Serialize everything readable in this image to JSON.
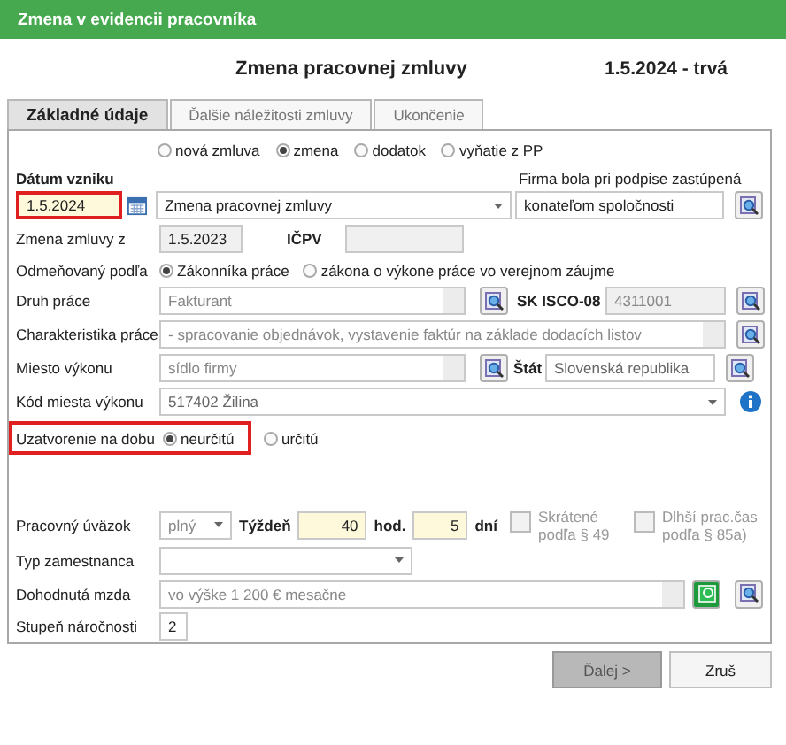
{
  "window": {
    "title": "Zmena v evidencii pracovníka"
  },
  "header": {
    "title": "Zmena pracovnej zmluvy",
    "period": "1.5.2024 - trvá"
  },
  "tabs": [
    {
      "label": "Základné údaje",
      "selected": true
    },
    {
      "label": "Ďalšie náležitosti zmluvy",
      "selected": false
    },
    {
      "label": "Ukončenie",
      "selected": false
    }
  ],
  "contract_type": [
    {
      "label": "nová zmluva",
      "selected": false
    },
    {
      "label": "zmena",
      "selected": true
    },
    {
      "label": "dodatok",
      "selected": false
    },
    {
      "label": "vyňatie z PP",
      "selected": false
    }
  ],
  "start_date": {
    "label": "Dátum vzniku",
    "value": "1.5.2024",
    "highlighted": true
  },
  "change_type": {
    "value": "Zmena pracovnej zmluvy"
  },
  "represented_by": {
    "label": "Firma bola pri podpise zastúpená",
    "value": "konateľom spoločnosti"
  },
  "changed_contract": {
    "label": "Zmena zmluvy z",
    "value": "1.5.2023"
  },
  "icpv": {
    "label": "IČPV"
  },
  "paid_by": {
    "label": "Odmeňovaný podľa",
    "options": [
      {
        "label": "Zákonníka práce",
        "selected": true
      },
      {
        "label": "zákona o výkone práce vo verejnom záujme",
        "selected": false
      }
    ]
  },
  "job": {
    "label": "Druh práce",
    "value": "Fakturant"
  },
  "isco": {
    "label": "SK ISCO-08",
    "value": "4311001"
  },
  "job_description": {
    "label": "Charakteristika práce",
    "value": "- spracovanie objednávok, vystavenie faktúr na základe dodacích listov"
  },
  "workplace": {
    "label": "Miesto výkonu",
    "value": "sídlo firmy"
  },
  "country": {
    "label": "Štát",
    "value": "Slovenská republika"
  },
  "workplace_code": {
    "label": "Kód miesta výkonu",
    "value": "517402 Žilina"
  },
  "duration": {
    "label": "Uzatvorenie na dobu",
    "highlighted": true,
    "options": [
      {
        "label": "neurčitú",
        "selected": true
      },
      {
        "label": "určitú",
        "selected": false
      }
    ]
  },
  "workload": {
    "label": "Pracovný úväzok",
    "value": "plný",
    "week_label": "Týždeň",
    "hours": "40",
    "hours_unit": "hod.",
    "days": "5",
    "days_unit": "dní",
    "checks": [
      {
        "label": "Skrátené podľa § 49",
        "checked": false,
        "disabled": true
      },
      {
        "label": "Dlhší prac.čas podľa § 85a)",
        "checked": false,
        "disabled": true
      }
    ]
  },
  "employee_type": {
    "label": "Typ zamestnanca"
  },
  "wage": {
    "label": "Dohodnutá mzda",
    "value": "vo výške 1 200 € mesačne"
  },
  "difficulty": {
    "label": "Stupeň náročnosti",
    "value": "2"
  },
  "buttons": [
    {
      "label": "Ďalej >",
      "kind": "default"
    },
    {
      "label": "Zruš",
      "kind": "normal"
    }
  ]
}
